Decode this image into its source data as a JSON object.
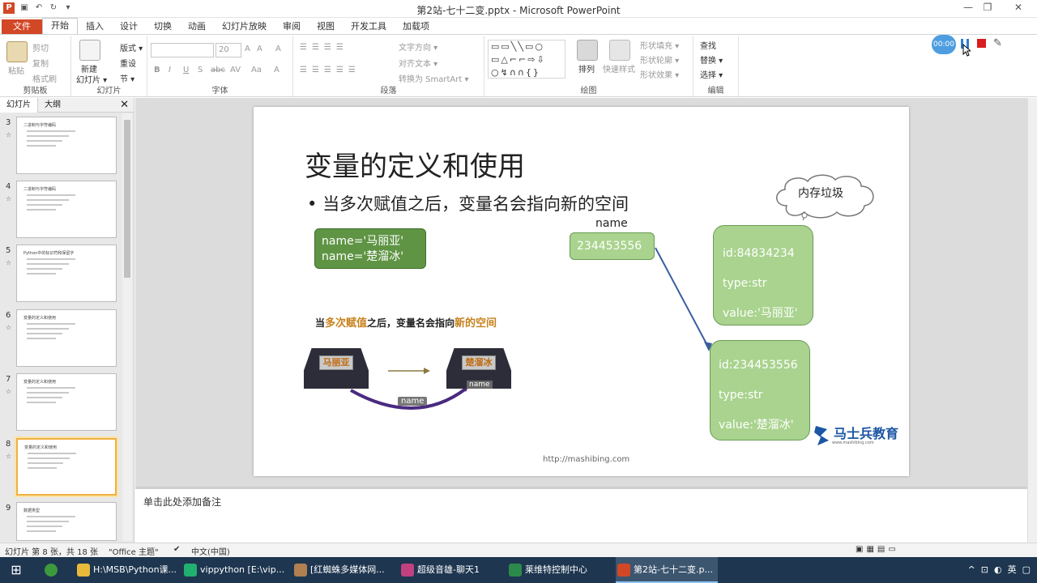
{
  "window": {
    "title": "第2站-七十二变.pptx - Microsoft PowerPoint",
    "buttons": {
      "minimize": "—",
      "restore": "❐",
      "close": "✕"
    }
  },
  "ribbon_tabs": [
    "文件",
    "开始",
    "插入",
    "设计",
    "切换",
    "动画",
    "幻灯片放映",
    "审阅",
    "视图",
    "开发工具",
    "加载项"
  ],
  "ribbon": {
    "clipboard": {
      "paste": "粘贴",
      "cut": "剪切",
      "copy": "复制",
      "format_painter": "格式刷",
      "label": "剪贴板"
    },
    "slides": {
      "new_slide": "新建",
      "new_slide2": "幻灯片 ▾",
      "layout": "版式 ▾",
      "reset": "重设",
      "section": "节 ▾",
      "label": "幻灯片"
    },
    "font": {
      "size": "20",
      "label": "字体",
      "buttons": [
        "B",
        "I",
        "U",
        "S",
        "abc",
        "AV",
        "Aa",
        "A"
      ]
    },
    "paragraph": {
      "text_direction": "文字方向 ▾",
      "align_text": "对齐文本 ▾",
      "smartart": "转换为 SmartArt ▾",
      "label": "段落"
    },
    "drawing": {
      "arrange": "排列",
      "quick_styles": "快速样式",
      "shape_fill": "形状填充 ▾",
      "shape_outline": "形状轮廓 ▾",
      "shape_effects": "形状效果 ▾",
      "label": "绘图"
    },
    "editing": {
      "find": "查找",
      "replace": "替换 ▾",
      "select": "选择 ▾",
      "label": "编辑"
    }
  },
  "recorder": {
    "timer": "00:00"
  },
  "slide_panel": {
    "tabs": [
      "幻灯片",
      "大纲"
    ],
    "close": "✕",
    "thumbnails": [
      {
        "num": "3",
        "title": "二进制与字符编码"
      },
      {
        "num": "4",
        "title": "二进制与字符编码"
      },
      {
        "num": "5",
        "title": "Python中的标识符和保留字"
      },
      {
        "num": "6",
        "title": "变量的定义和使用"
      },
      {
        "num": "7",
        "title": "变量的定义和使用"
      },
      {
        "num": "8",
        "title": "变量的定义和使用"
      },
      {
        "num": "9",
        "title": "数据类型"
      }
    ]
  },
  "slide": {
    "title": "变量的定义和使用",
    "bullet": "当多次赋值之后，变量名会指向新的空间",
    "name_box": {
      "line1": "name='马丽亚'",
      "line2": "name='楚溜冰'"
    },
    "name_label": "name",
    "address": "234453556",
    "cloud": "内存垃圾",
    "obj1": {
      "id": "id:84834234",
      "type": "type:str",
      "value": "value:'马丽亚'"
    },
    "obj2": {
      "id": "id:234453556",
      "type": "type:str",
      "value": "value:'楚溜冰'"
    },
    "caption": {
      "p1": "当",
      "h1": "多次赋值",
      "p2": "之后，变量名会指向",
      "h2": "新的空间"
    },
    "house1": "马丽亚",
    "house2": "楚溜冰",
    "house2_tag": "name",
    "arrow_tag": "name",
    "footer": "http://mashibing.com",
    "brand": "马士兵教育",
    "brand_sub": "www.mashibing.com"
  },
  "notes_placeholder": "单击此处添加备注",
  "status": {
    "slide_info": "幻灯片 第 8 张，共 18 张",
    "theme": "\"Office 主题\"",
    "language": "中文(中国)"
  },
  "taskbar": {
    "items": [
      "H:\\MSB\\Python课...",
      "vippython [E:\\vip...",
      "[红蜘蛛多媒体网...",
      "超级音雄-聊天1",
      "莱维特控制中心",
      "第2站-七十二变.p..."
    ],
    "tray": "英"
  },
  "colors": {
    "accent": "#d24726",
    "box_green": "#a9d38e",
    "box_dark_green": "#5e9444",
    "arrow": "#3a5fa0",
    "brand": "#1c56a4"
  }
}
